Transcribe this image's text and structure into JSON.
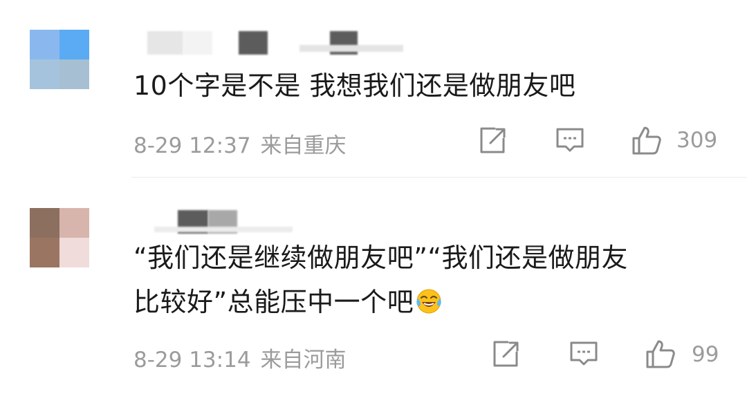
{
  "comments": [
    {
      "text": "10个字是不是 我想我们还是做朋友吧",
      "time": "8-29 12:37",
      "location": "来自重庆",
      "likes": "309",
      "avatar_colors": [
        "#8ab8ee",
        "#5aabf3",
        "#a5c3dc",
        "#a7bfd2"
      ],
      "icons": {
        "share": "share-icon",
        "reply": "comment-icon",
        "like": "thumbs-up-icon"
      }
    },
    {
      "text_line1": "“我们还是继续做朋友吧”“我们还是做朋友",
      "text_line2": "比较好”总能压中一个吧",
      "emoji": "laughing-crying-emoji",
      "time": "8-29 13:14",
      "location": "来自河南",
      "likes": "99",
      "avatar_colors": [
        "#8c6f5f",
        "#d8b5ac",
        "#9a7561",
        "#f1dcdc"
      ],
      "icons": {
        "share": "share-icon",
        "reply": "comment-icon",
        "like": "thumbs-up-icon"
      }
    }
  ],
  "colors": {
    "text": "#1a1a1a",
    "meta": "#9b9b9b",
    "icon": "#8a8a8a",
    "divider": "#ececec"
  }
}
